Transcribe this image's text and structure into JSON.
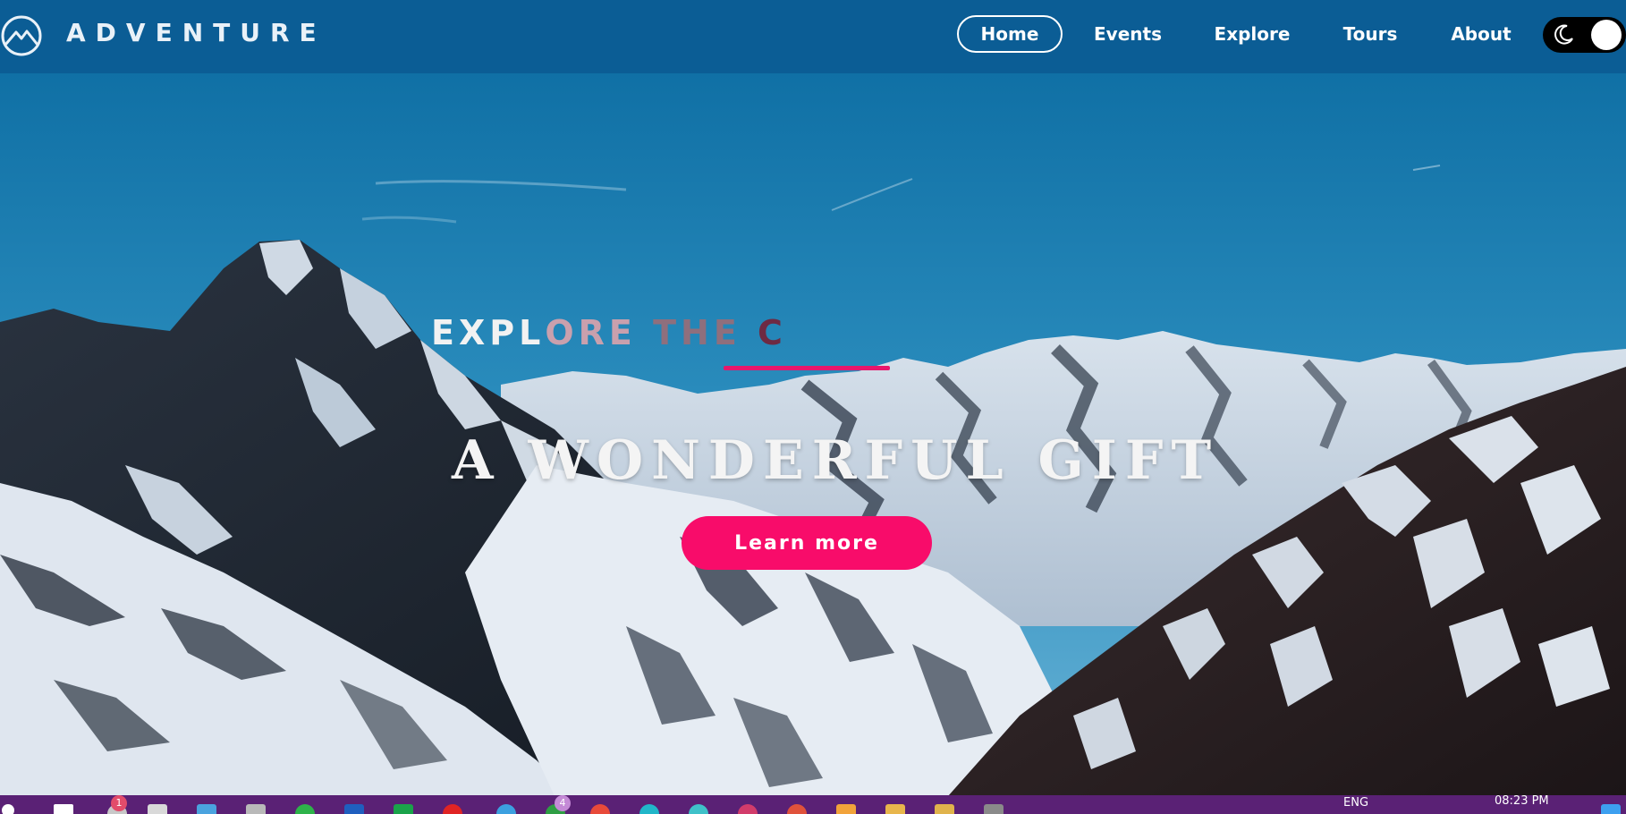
{
  "brand": {
    "name": "ADVENTURE",
    "logo_icon": "mountain-logo-icon"
  },
  "nav": {
    "items": [
      {
        "label": "Home",
        "active": true
      },
      {
        "label": "Events",
        "active": false
      },
      {
        "label": "Explore",
        "active": false
      },
      {
        "label": "Tours",
        "active": false
      },
      {
        "label": "About",
        "active": false
      }
    ]
  },
  "theme_toggle": {
    "icon": "moon-icon",
    "state": "off"
  },
  "hero": {
    "eyebrow": "EXPLORE THE C",
    "headline": "A WONDERFUL GIFT",
    "cta_label": "Learn more"
  },
  "taskbar": {
    "language": "ENG",
    "time": "08:23 PM",
    "badge_counts": [
      "1",
      "4"
    ]
  },
  "colors": {
    "header_bg": "#0b5d95",
    "accent": "#f80c6a",
    "underline": "#e8166b",
    "taskbar_bg": "#5a2175",
    "toggle_bg": "#000000"
  }
}
